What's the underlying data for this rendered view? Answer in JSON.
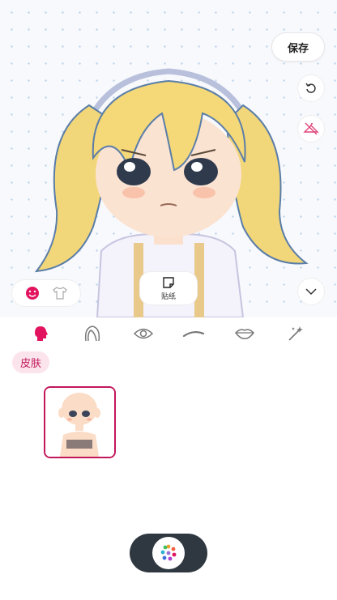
{
  "toolbar": {
    "save_label": "保存"
  },
  "preview": {
    "sticker_label": "贴纸"
  },
  "categories": [
    {
      "icon": "head-icon",
      "active": true
    },
    {
      "icon": "hair-icon",
      "active": false
    },
    {
      "icon": "eye-icon",
      "active": false
    },
    {
      "icon": "eyebrow-icon",
      "active": false
    },
    {
      "icon": "mouth-icon",
      "active": false
    },
    {
      "icon": "magic-wand-icon",
      "active": false
    }
  ],
  "subcategory": {
    "label": "皮肤"
  },
  "colors": {
    "accent": "#c2185b",
    "accent_light": "#fce4ec",
    "dock": "#2f3740"
  }
}
